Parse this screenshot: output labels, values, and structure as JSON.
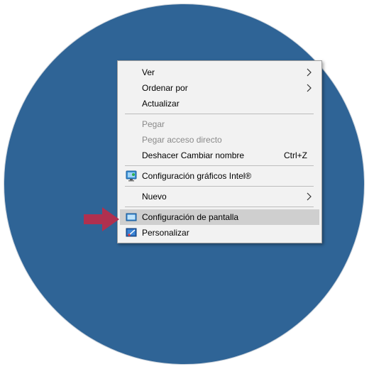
{
  "menu": {
    "items": [
      {
        "label": "Ver",
        "submenu": true,
        "state": "normal"
      },
      {
        "label": "Ordenar por",
        "submenu": true,
        "state": "normal"
      },
      {
        "label": "Actualizar",
        "state": "normal"
      },
      {
        "label": "Pegar",
        "state": "disabled"
      },
      {
        "label": "Pegar acceso directo",
        "state": "disabled"
      },
      {
        "label": "Deshacer Cambiar nombre",
        "shortcut": "Ctrl+Z",
        "state": "normal"
      },
      {
        "label": "Configuración gráficos Intel®",
        "icon": "intel-graphics-icon",
        "state": "normal"
      },
      {
        "label": "Nuevo",
        "submenu": true,
        "state": "normal"
      },
      {
        "label": "Configuración de pantalla",
        "icon": "display-settings-icon",
        "state": "highlighted"
      },
      {
        "label": "Personalizar",
        "icon": "personalize-icon",
        "state": "normal"
      }
    ]
  },
  "colors": {
    "background_circle": "#2f6496",
    "menu_background": "#f2f2f2",
    "highlight": "#cfcfcf",
    "disabled_text": "#8a8a8a",
    "pointer_arrow": "#b0304f"
  },
  "pointer": {
    "icon": "pointer-arrow-icon"
  }
}
